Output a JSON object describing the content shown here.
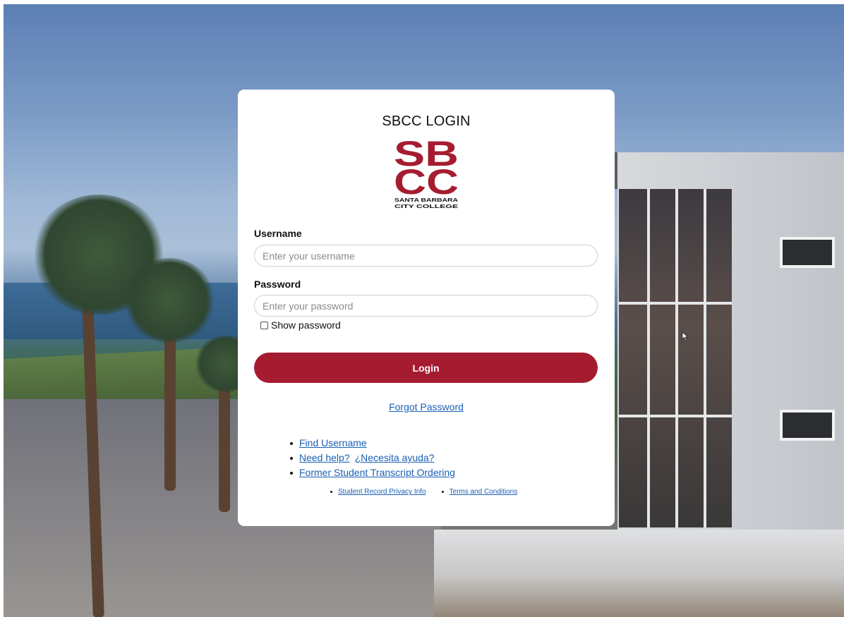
{
  "colors": {
    "brand_red": "#a51c30",
    "link_blue": "#1a5fb4",
    "card_bg": "#ffffff"
  },
  "login_card": {
    "title": "SBCC LOGIN",
    "logo": {
      "line1": "SB",
      "line2": "CC",
      "subtitle1": "SANTA BARBARA",
      "subtitle2": "CITY COLLEGE"
    },
    "username": {
      "label": "Username",
      "value": "",
      "placeholder": "Enter your username"
    },
    "password": {
      "label": "Password",
      "value": "",
      "placeholder": "Enter your password"
    },
    "show_password": {
      "label": "Show password",
      "checked": false
    },
    "login_button": "Login",
    "forgot_password": "Forgot Password",
    "help_links": {
      "find_username": "Find Username",
      "need_help": "Need help?",
      "necesita_ayuda": "¿Necesita ayuda?",
      "transcript": "Former Student Transcript Ordering"
    },
    "footer_links": {
      "privacy": "Student Record Privacy Info",
      "terms": "Terms and Conditions"
    }
  }
}
